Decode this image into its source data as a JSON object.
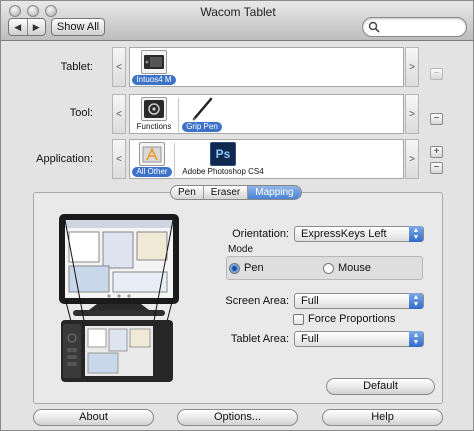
{
  "window": {
    "title": "Wacom Tablet"
  },
  "toolbar": {
    "back_label": "◀",
    "forward_label": "▶",
    "show_all_label": "Show All",
    "search_value": ""
  },
  "rows": {
    "tablet": {
      "label": "Tablet:",
      "items": [
        {
          "caption": "Intuos4 M",
          "selected": true
        }
      ]
    },
    "tool": {
      "label": "Tool:",
      "items": [
        {
          "caption": "Functions",
          "selected": false
        },
        {
          "caption": "Grip Pen",
          "selected": true
        }
      ]
    },
    "application": {
      "label": "Application:",
      "items": [
        {
          "caption": "All Other",
          "selected": true
        },
        {
          "caption": "Adobe Photoshop CS4",
          "selected": false
        }
      ],
      "ps_text": "Ps"
    }
  },
  "nav": {
    "left": "<",
    "right": ">"
  },
  "buttons": {
    "minus": "−",
    "plus": "+"
  },
  "tabs": [
    {
      "label": "Pen",
      "selected": false
    },
    {
      "label": "Eraser",
      "selected": false
    },
    {
      "label": "Mapping",
      "selected": true
    }
  ],
  "mapping": {
    "orientation": {
      "label": "Orientation:",
      "value": "ExpressKeys Left"
    },
    "mode": {
      "label": "Mode",
      "options": [
        {
          "label": "Pen",
          "selected": true
        },
        {
          "label": "Mouse",
          "selected": false
        }
      ]
    },
    "screen_area": {
      "label": "Screen Area:",
      "value": "Full"
    },
    "force_proportions": {
      "label": "Force Proportions",
      "checked": false
    },
    "tablet_area": {
      "label": "Tablet Area:",
      "value": "Full"
    },
    "default_label": "Default"
  },
  "footer": {
    "about": "About",
    "options": "Options...",
    "help": "Help"
  }
}
